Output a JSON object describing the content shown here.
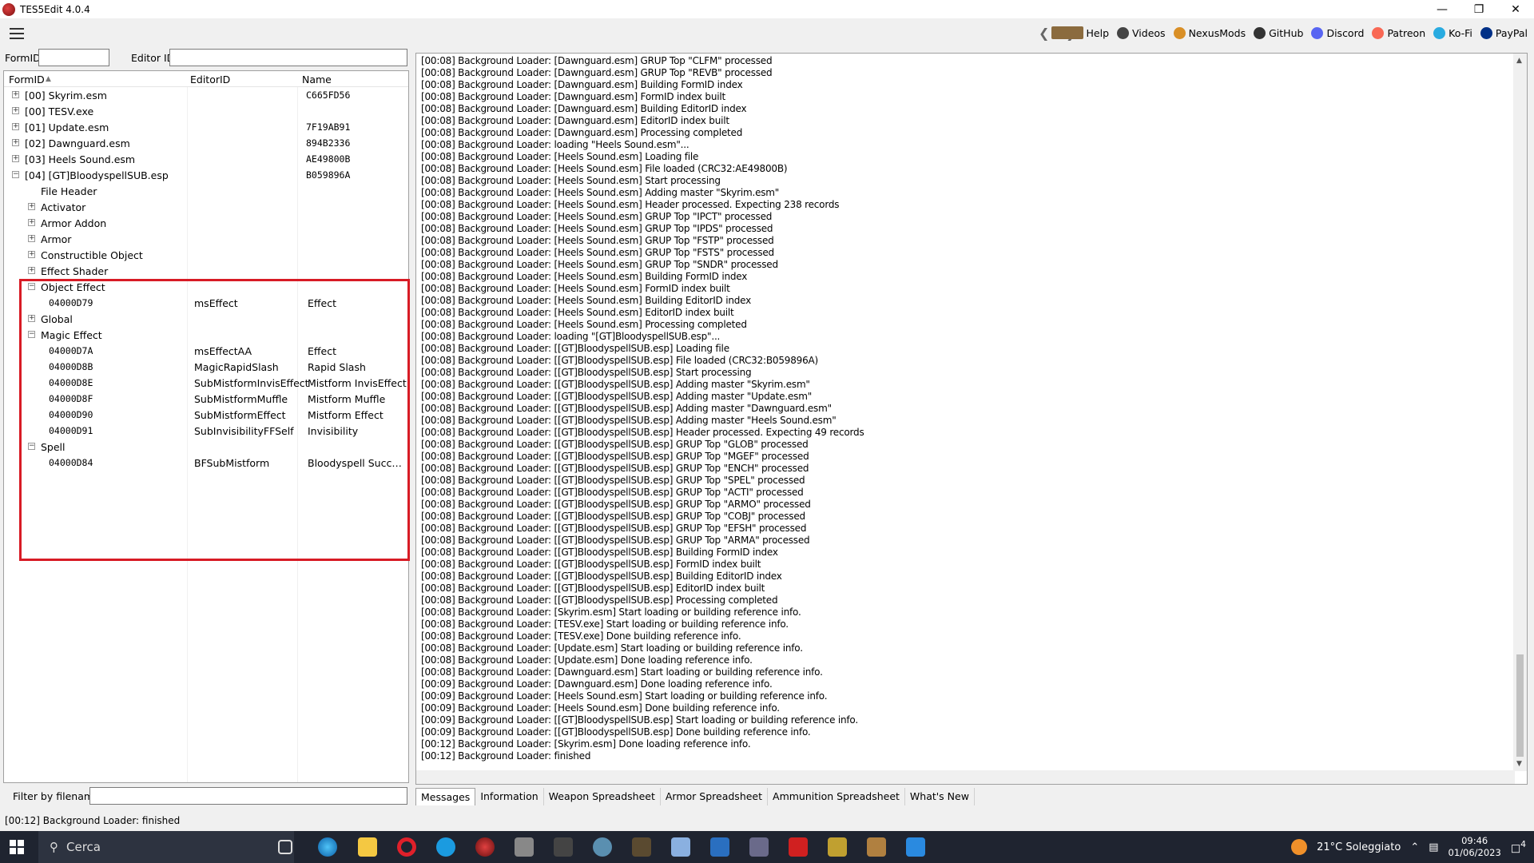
{
  "window": {
    "title": "TES5Edit 4.0.4"
  },
  "toolbar": {
    "links": [
      {
        "label": "Help",
        "icon": "book-icon",
        "color": "#8b6b3e"
      },
      {
        "label": "Videos",
        "icon": "film-icon",
        "color": "#444444"
      },
      {
        "label": "NexusMods",
        "icon": "nexus-icon",
        "color": "#d98f26"
      },
      {
        "label": "GitHub",
        "icon": "github-icon",
        "color": "#333333"
      },
      {
        "label": "Discord",
        "icon": "discord-icon",
        "color": "#5865f2"
      },
      {
        "label": "Patreon",
        "icon": "patreon-icon",
        "color": "#f96854"
      },
      {
        "label": "Ko-Fi",
        "icon": "kofi-icon",
        "color": "#29abe0"
      },
      {
        "label": "PayPal",
        "icon": "paypal-icon",
        "color": "#003087"
      }
    ]
  },
  "search": {
    "formid_label": "FormID",
    "editorid_label": "Editor ID",
    "formid_value": "",
    "editorid_value": ""
  },
  "tree": {
    "headers": [
      "FormID",
      "EditorID",
      "Name"
    ],
    "rows": [
      {
        "label": "[00] Skyrim.esm",
        "hex": "C665FD56",
        "editorid": "",
        "name": ""
      },
      {
        "label": "[00] TESV.exe",
        "hex": "",
        "editorid": "",
        "name": ""
      },
      {
        "label": "[01] Update.esm",
        "hex": "7F19AB91",
        "editorid": "",
        "name": ""
      },
      {
        "label": "[02] Dawnguard.esm",
        "hex": "894B2336",
        "editorid": "",
        "name": ""
      },
      {
        "label": "[03] Heels Sound.esm",
        "hex": "AE49800B",
        "editorid": "",
        "name": ""
      },
      {
        "label": "[04] [GT]BloodyspellSUB.esp",
        "hex": "B059896A",
        "editorid": "",
        "name": ""
      },
      {
        "label": "File Header",
        "hex": "",
        "editorid": "",
        "name": ""
      },
      {
        "label": "Activator",
        "hex": "",
        "editorid": "",
        "name": ""
      },
      {
        "label": "Armor Addon",
        "hex": "",
        "editorid": "",
        "name": ""
      },
      {
        "label": "Armor",
        "hex": "",
        "editorid": "",
        "name": ""
      },
      {
        "label": "Constructible Object",
        "hex": "",
        "editorid": "",
        "name": ""
      },
      {
        "label": "Effect Shader",
        "hex": "",
        "editorid": "",
        "name": ""
      },
      {
        "label": "Object Effect",
        "hex": "",
        "editorid": "",
        "name": ""
      },
      {
        "label": "04000D79",
        "hex": "",
        "editorid": "msEffect",
        "name": "Effect"
      },
      {
        "label": "Global",
        "hex": "",
        "editorid": "",
        "name": ""
      },
      {
        "label": "Magic Effect",
        "hex": "",
        "editorid": "",
        "name": ""
      },
      {
        "label": "04000D7A",
        "hex": "",
        "editorid": "msEffectAA",
        "name": "Effect"
      },
      {
        "label": "04000D8B",
        "hex": "",
        "editorid": "MagicRapidSlash",
        "name": "Rapid Slash"
      },
      {
        "label": "04000D8E",
        "hex": "",
        "editorid": "SubMistformInvisEffect",
        "name": "Mistform InvisEffect"
      },
      {
        "label": "04000D8F",
        "hex": "",
        "editorid": "SubMistformMuffle",
        "name": "Mistform Muffle"
      },
      {
        "label": "04000D90",
        "hex": "",
        "editorid": "SubMistformEffect",
        "name": "Mistform Effect"
      },
      {
        "label": "04000D91",
        "hex": "",
        "editorid": "SubInvisibilityFFSelf",
        "name": "Invisibility"
      },
      {
        "label": "Spell",
        "hex": "",
        "editorid": "",
        "name": ""
      },
      {
        "label": "04000D84",
        "hex": "",
        "editorid": "BFSubMistform",
        "name": "Bloodyspell Succubu..."
      }
    ]
  },
  "filter": {
    "label": "Filter by filename:",
    "value": ""
  },
  "log": [
    "[00:08] Background Loader: [Dawnguard.esm] GRUP Top \"CLFM\" processed",
    "[00:08] Background Loader: [Dawnguard.esm] GRUP Top \"REVB\" processed",
    "[00:08] Background Loader: [Dawnguard.esm] Building FormID index",
    "[00:08] Background Loader: [Dawnguard.esm] FormID index built",
    "[00:08] Background Loader: [Dawnguard.esm] Building EditorID index",
    "[00:08] Background Loader: [Dawnguard.esm] EditorID index built",
    "[00:08] Background Loader: [Dawnguard.esm] Processing completed",
    "[00:08] Background Loader: loading \"Heels Sound.esm\"...",
    "[00:08] Background Loader: [Heels Sound.esm] Loading file",
    "[00:08] Background Loader: [Heels Sound.esm] File loaded (CRC32:AE49800B)",
    "[00:08] Background Loader: [Heels Sound.esm] Start processing",
    "[00:08] Background Loader: [Heels Sound.esm] Adding master \"Skyrim.esm\"",
    "[00:08] Background Loader: [Heels Sound.esm] Header processed. Expecting 238 records",
    "[00:08] Background Loader: [Heels Sound.esm] GRUP Top \"IPCT\" processed",
    "[00:08] Background Loader: [Heels Sound.esm] GRUP Top \"IPDS\" processed",
    "[00:08] Background Loader: [Heels Sound.esm] GRUP Top \"FSTP\" processed",
    "[00:08] Background Loader: [Heels Sound.esm] GRUP Top \"FSTS\" processed",
    "[00:08] Background Loader: [Heels Sound.esm] GRUP Top \"SNDR\" processed",
    "[00:08] Background Loader: [Heels Sound.esm] Building FormID index",
    "[00:08] Background Loader: [Heels Sound.esm] FormID index built",
    "[00:08] Background Loader: [Heels Sound.esm] Building EditorID index",
    "[00:08] Background Loader: [Heels Sound.esm] EditorID index built",
    "[00:08] Background Loader: [Heels Sound.esm] Processing completed",
    "[00:08] Background Loader: loading \"[GT]BloodyspellSUB.esp\"...",
    "[00:08] Background Loader: [[GT]BloodyspellSUB.esp] Loading file",
    "[00:08] Background Loader: [[GT]BloodyspellSUB.esp] File loaded (CRC32:B059896A)",
    "[00:08] Background Loader: [[GT]BloodyspellSUB.esp] Start processing",
    "[00:08] Background Loader: [[GT]BloodyspellSUB.esp] Adding master \"Skyrim.esm\"",
    "[00:08] Background Loader: [[GT]BloodyspellSUB.esp] Adding master \"Update.esm\"",
    "[00:08] Background Loader: [[GT]BloodyspellSUB.esp] Adding master \"Dawnguard.esm\"",
    "[00:08] Background Loader: [[GT]BloodyspellSUB.esp] Adding master \"Heels Sound.esm\"",
    "[00:08] Background Loader: [[GT]BloodyspellSUB.esp] Header processed. Expecting 49 records",
    "[00:08] Background Loader: [[GT]BloodyspellSUB.esp] GRUP Top \"GLOB\" processed",
    "[00:08] Background Loader: [[GT]BloodyspellSUB.esp] GRUP Top \"MGEF\" processed",
    "[00:08] Background Loader: [[GT]BloodyspellSUB.esp] GRUP Top \"ENCH\" processed",
    "[00:08] Background Loader: [[GT]BloodyspellSUB.esp] GRUP Top \"SPEL\" processed",
    "[00:08] Background Loader: [[GT]BloodyspellSUB.esp] GRUP Top \"ACTI\" processed",
    "[00:08] Background Loader: [[GT]BloodyspellSUB.esp] GRUP Top \"ARMO\" processed",
    "[00:08] Background Loader: [[GT]BloodyspellSUB.esp] GRUP Top \"COBJ\" processed",
    "[00:08] Background Loader: [[GT]BloodyspellSUB.esp] GRUP Top \"EFSH\" processed",
    "[00:08] Background Loader: [[GT]BloodyspellSUB.esp] GRUP Top \"ARMA\" processed",
    "[00:08] Background Loader: [[GT]BloodyspellSUB.esp] Building FormID index",
    "[00:08] Background Loader: [[GT]BloodyspellSUB.esp] FormID index built",
    "[00:08] Background Loader: [[GT]BloodyspellSUB.esp] Building EditorID index",
    "[00:08] Background Loader: [[GT]BloodyspellSUB.esp] EditorID index built",
    "[00:08] Background Loader: [[GT]BloodyspellSUB.esp] Processing completed",
    "[00:08] Background Loader: [Skyrim.esm] Start loading or building reference info.",
    "[00:08] Background Loader: [TESV.exe] Start loading or building reference info.",
    "[00:08] Background Loader: [TESV.exe] Done building reference info.",
    "[00:08] Background Loader: [Update.esm] Start loading or building reference info.",
    "[00:08] Background Loader: [Update.esm] Done loading reference info.",
    "[00:08] Background Loader: [Dawnguard.esm] Start loading or building reference info.",
    "[00:09] Background Loader: [Dawnguard.esm] Done loading reference info.",
    "[00:09] Background Loader: [Heels Sound.esm] Start loading or building reference info.",
    "[00:09] Background Loader: [Heels Sound.esm] Done building reference info.",
    "[00:09] Background Loader: [[GT]BloodyspellSUB.esp] Start loading or building reference info.",
    "[00:09] Background Loader: [[GT]BloodyspellSUB.esp] Done building reference info.",
    "[00:12] Background Loader: [Skyrim.esm] Done loading reference info.",
    "[00:12] Background Loader: finished"
  ],
  "tabs": [
    "Messages",
    "Information",
    "Weapon Spreadsheet",
    "Armor Spreadsheet",
    "Ammunition Spreadsheet",
    "What's New"
  ],
  "status": "[00:12] Background Loader: finished",
  "taskbar": {
    "search_placeholder": "Cerca",
    "weather": "21°C  Soleggiato",
    "time": "09:46",
    "date": "01/06/2023",
    "notification_count": "4"
  }
}
